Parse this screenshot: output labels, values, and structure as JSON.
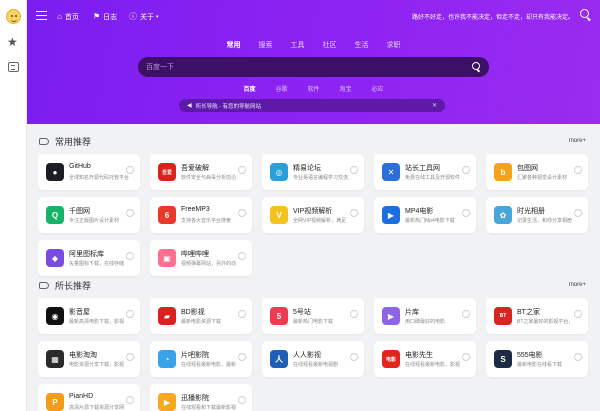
{
  "topnav": {
    "items": [
      {
        "label": "首页",
        "icon": "home-icon",
        "glyph": "⌂"
      },
      {
        "label": "日志",
        "icon": "flag-icon",
        "glyph": "⚑"
      },
      {
        "label": "关于",
        "icon": "info-icon",
        "glyph": "ⓘ",
        "caret": "▾"
      }
    ],
    "notice": "路好不好走，也许我不能决定，但走不走，却只有我能决定。"
  },
  "categories": {
    "tabs": [
      "常用",
      "搜索",
      "工具",
      "社区",
      "生活",
      "求职"
    ],
    "active": "常用"
  },
  "search": {
    "placeholder": "百度一下"
  },
  "engines": {
    "tabs": [
      "百度",
      "谷歌",
      "软件",
      "淘宝",
      "必应"
    ],
    "active": "百度"
  },
  "hotbar": {
    "text": "所长导航 - 有您的导航网站"
  },
  "sections": [
    {
      "title": "常用推荐",
      "more": "more+",
      "cards": [
        {
          "name": "GitHub",
          "desc": "全球知名开源代码托管平台",
          "icon_color": "#1b1f23",
          "icon_text": "●"
        },
        {
          "name": "吾爱破解",
          "desc": "软件安全与病毒分析前沿",
          "icon_color": "#d8241c",
          "icon_text": "吾爱"
        },
        {
          "name": "精易论坛",
          "desc": "专业易语言编程学习交流",
          "icon_color": "#2b9fd8",
          "icon_text": "◎"
        },
        {
          "name": "站长工具网",
          "desc": "免费在线工具及开源软件",
          "icon_color": "#2d6fd8",
          "icon_text": "✕"
        },
        {
          "name": "包图网",
          "desc": "汇聚各种视觉设计素材",
          "icon_color": "#f3a21a",
          "icon_text": "b"
        },
        {
          "name": "千图网",
          "desc": "专注正版图片设计素材",
          "icon_color": "#18b36b",
          "icon_text": "Q"
        },
        {
          "name": "FreeMP3",
          "desc": "支持各大音乐平台搜索",
          "icon_color": "#e83a2a",
          "icon_text": "6"
        },
        {
          "name": "VIP视频解析",
          "desc": "全网VIP视频解析，满足",
          "icon_color": "#f4c21c",
          "icon_text": "V"
        },
        {
          "name": "MP4电影",
          "desc": "最新热门Mp4电影下载",
          "icon_color": "#1d6fe0",
          "icon_text": "▶"
        },
        {
          "name": "时光相册",
          "desc": "记录生活，和你分享相册",
          "icon_color": "#49a6d8",
          "icon_text": "✿"
        },
        {
          "name": "阿里图标库",
          "desc": "矢量图标下载，在线存储",
          "icon_color": "#7a4be0",
          "icon_text": "◆"
        },
        {
          "name": "哔哩哔哩",
          "desc": "视频弹幕网站，另外的动",
          "icon_color": "#ff6f8f",
          "icon_text": "▣"
        }
      ]
    },
    {
      "title": "所长推荐",
      "more": "more+",
      "cards": [
        {
          "name": "影音屋",
          "desc": "最新高清电影下载，影视",
          "icon_color": "#111111",
          "icon_text": "◉"
        },
        {
          "name": "BD影视",
          "desc": "最新电影资源下载",
          "icon_color": "#d92220",
          "icon_text": "▰"
        },
        {
          "name": "5号站",
          "desc": "最新热门电影下载",
          "icon_color": "#ef3b52",
          "icon_text": "5"
        },
        {
          "name": "片库",
          "desc": "用口碑最好的电影",
          "icon_color": "#8f63e8",
          "icon_text": "▶"
        },
        {
          "name": "BT之家",
          "desc": "BT之家最好的影视平台，",
          "icon_color": "#d6261e",
          "icon_text": "BT"
        },
        {
          "name": "电影淘淘",
          "desc": "电影资源分享下载，影视",
          "icon_color": "#2a2a2a",
          "icon_text": "▦"
        },
        {
          "name": "片吧影院",
          "desc": "在线观看最新电影，最新",
          "icon_color": "#39a3e8",
          "icon_text": "◔"
        },
        {
          "name": "人人影视",
          "desc": "在线观看最新电视剧",
          "icon_color": "#1f5fb8",
          "icon_text": "人"
        },
        {
          "name": "电影先生",
          "desc": "在线观看最新电影，影视",
          "icon_color": "#e2261e",
          "icon_text": "电影"
        },
        {
          "name": "555电影",
          "desc": "最新电影在线看下载",
          "icon_color": "#1d2a44",
          "icon_text": "S"
        },
        {
          "name": "PianHD",
          "desc": "高清片源下载资源分享网",
          "icon_color": "#f39b1a",
          "icon_text": "P"
        },
        {
          "name": "迅播影院",
          "desc": "在线观看和下载最新影视",
          "icon_color": "#f6a821",
          "icon_text": "▶"
        }
      ]
    }
  ]
}
